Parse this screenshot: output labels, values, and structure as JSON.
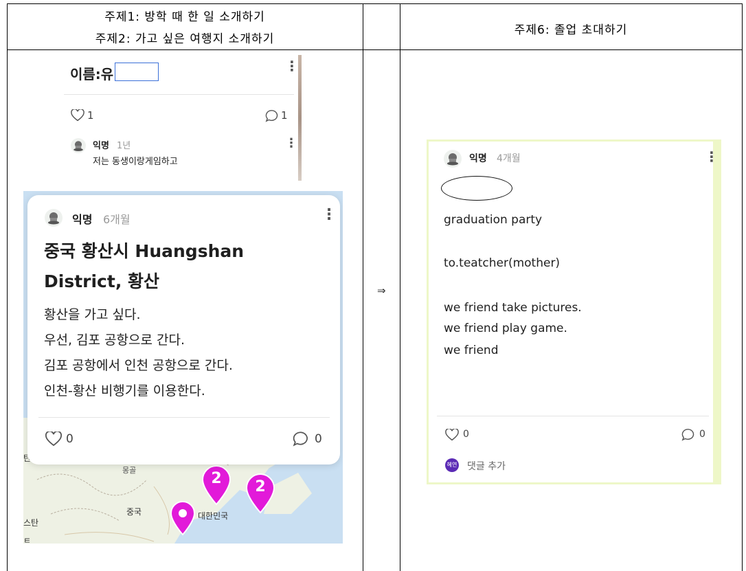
{
  "table": {
    "left_header_line1": "주제1: 방학 때 한 일 소개하기",
    "left_header_line2": "주제2: 가고 싶은 여행지 소개하기",
    "right_header": "주제6: 졸업 초대하기",
    "arrow": "⇒"
  },
  "top_post": {
    "name_label": "이름:유",
    "likes": "1",
    "comments": "1",
    "comment": {
      "author": "익명",
      "time": "1년",
      "text": "저는 동생이랑게임하고"
    }
  },
  "map_post": {
    "author": "익명",
    "time": "6개월",
    "title_line1": "중국 황산시 Huangshan",
    "title_line2": "District, 황산",
    "body": [
      "황산을 가고 싶다.",
      "우선, 김포 공항으로 간다.",
      "김포 공항에서 인천 공항으로 간다.",
      "인천-황산 비행기를 이용한다."
    ],
    "likes": "0",
    "comments": "0",
    "map": {
      "label_china": "중국",
      "label_korea": "대한민국",
      "label_mongolia_partial": "몽골",
      "label_left1": "탄",
      "label_left2": "스탄",
      "label_left3": "ㅌ",
      "cluster1": "2",
      "cluster2": "2"
    }
  },
  "right_post": {
    "author": "익명",
    "time": "4개월",
    "lines": [
      "graduation party",
      "",
      "to.teatcher(mother)",
      "",
      "we friend take pictures.",
      "we friend play game.",
      "we friend"
    ],
    "likes": "0",
    "comments": "0",
    "user_badge": "혜연",
    "add_comment": "댓글 추가"
  },
  "colors": {
    "map_pin": "#e21ad9",
    "badge": "#5b2bb5",
    "right_card_border": "#eef7c8"
  }
}
